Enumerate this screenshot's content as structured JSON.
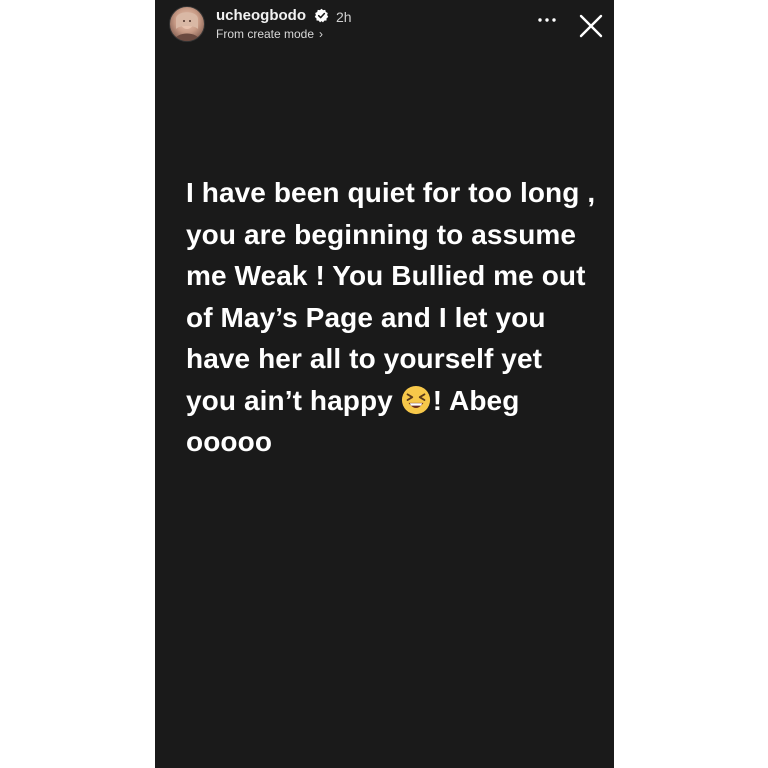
{
  "story": {
    "username": "ucheogbodo",
    "time_ago": "2h",
    "subtitle": "From create mode",
    "subtitle_chevron": "›",
    "icons": {
      "avatar": "profile-photo",
      "verified": "verified-badge-icon",
      "more": "more-dots-icon",
      "close": "close-icon",
      "emoji": "grinning-squinting-face-emoji"
    },
    "message": {
      "text_before_emoji": "I have been quiet for too long , you are beginning to assume me Weak ! You Bullied me out of May’s Page and I let you have her all to yourself yet you ain’t happy",
      "text_after_emoji": "! Abeg ooooo"
    },
    "colors": {
      "background": "#1a1a1a",
      "text": "#ffffff",
      "verified": "#3d95ef"
    }
  }
}
